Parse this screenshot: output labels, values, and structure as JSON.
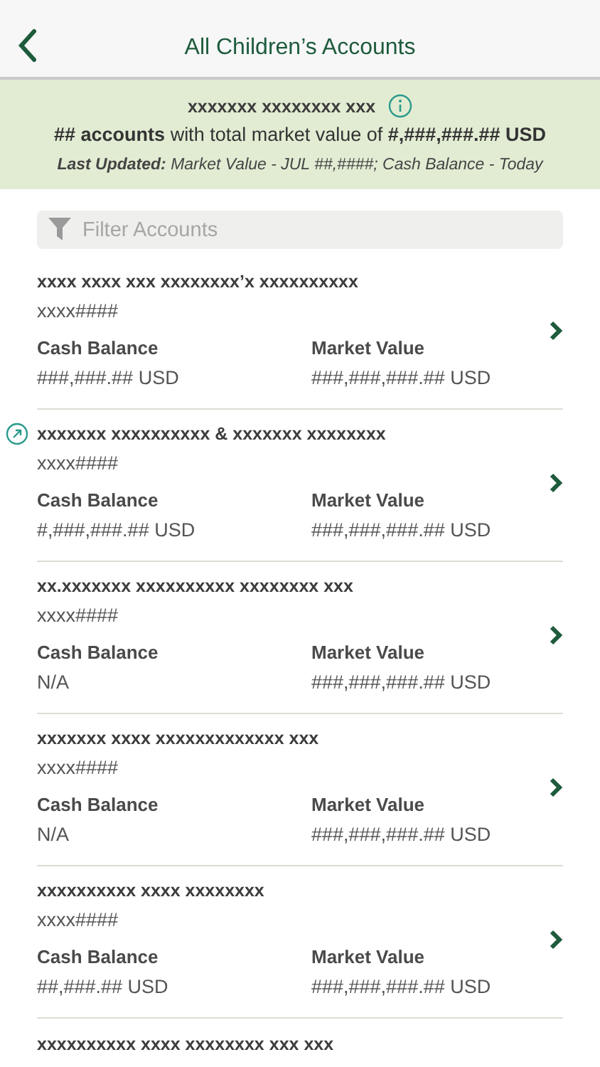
{
  "header": {
    "title": "All Children’s Accounts"
  },
  "summary": {
    "title": "xxxxxxx xxxxxxxx xxx",
    "totals": "**## accounts** with total market value of **#,###,###.## USD**",
    "updated": "**Last Updated:** Market Value - JUL ##,####; Cash Balance - Today"
  },
  "filter": {
    "placeholder": "Filter Accounts"
  },
  "accounts": [
    {
      "name": "xxxx xxxx xxx xxxxxxxx’x xxxxxxxxxx",
      "number": "xxxx####",
      "linked": false,
      "cash_label": "Cash Balance",
      "cash": "###,###.## USD",
      "market_label": "Market Value",
      "market": "###,###,###.## USD"
    },
    {
      "name": "xxxxxxx xxxxxxxxxx & xxxxxxx xxxxxxxx",
      "number": "xxxx####",
      "linked": true,
      "cash_label": "Cash Balance",
      "cash": "#,###,###.## USD",
      "market_label": "Market Value",
      "market": "###,###,###.## USD"
    },
    {
      "name": "xx.xxxxxxx xxxxxxxxxx xxxxxxxx xxx",
      "number": "xxxx####",
      "linked": false,
      "cash_label": "Cash Balance",
      "cash": "N/A",
      "market_label": "Market Value",
      "market": "###,###,###.## USD"
    },
    {
      "name": "xxxxxxx xxxx xxxxxxxxxxxxx xxx",
      "number": "xxxx####",
      "linked": false,
      "cash_label": "Cash Balance",
      "cash": "N/A",
      "market_label": "Market Value",
      "market": "###,###,###.## USD"
    },
    {
      "name": "xxxxxxxxxx xxxx xxxxxxxx",
      "number": "xxxx####",
      "linked": false,
      "cash_label": "Cash Balance",
      "cash": "##,###.## USD",
      "market_label": "Market Value",
      "market": "###,###,###.## USD"
    },
    {
      "name": "xxxxxxxxxx xxxx xxxxxxxx xxx xxx",
      "linked": false
    }
  ]
}
